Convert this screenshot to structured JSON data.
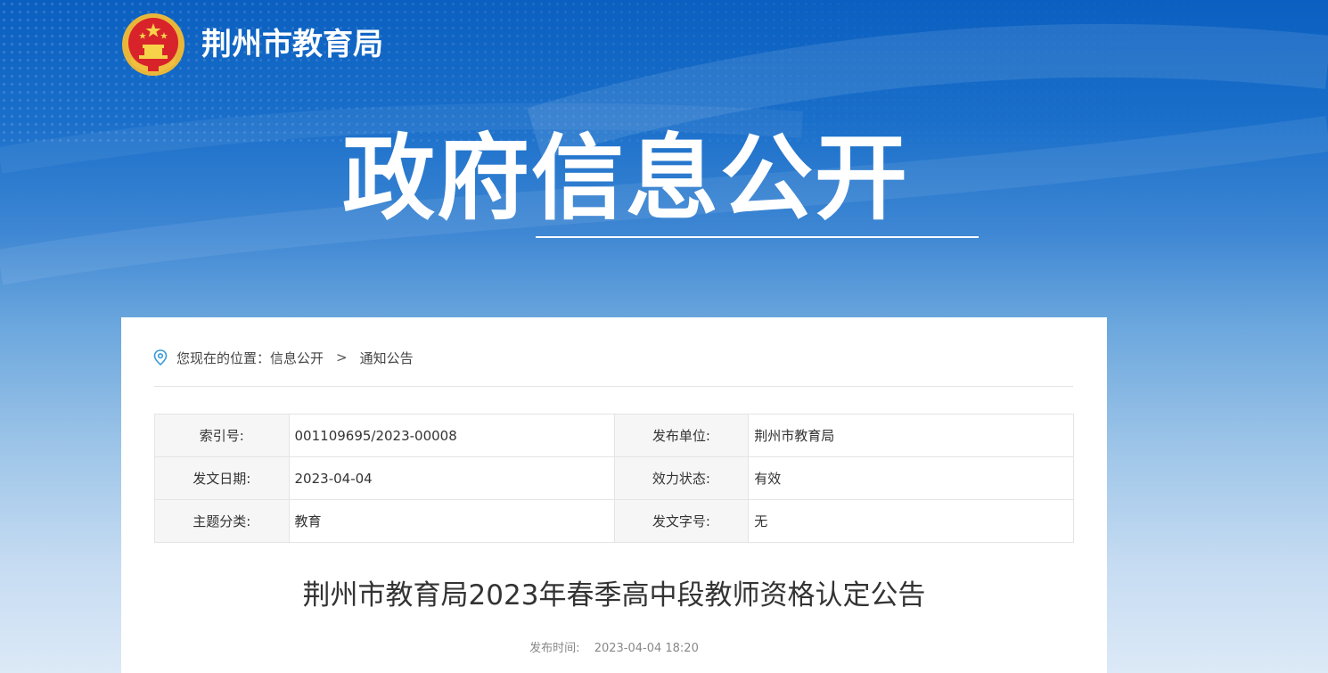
{
  "header": {
    "site_title": "荆州市教育局"
  },
  "banner": {
    "title": "政府信息公开"
  },
  "breadcrumb": {
    "prefix": "您现在的位置：",
    "items": [
      "信息公开",
      "通知公告"
    ],
    "separator": ">"
  },
  "meta": {
    "rows": [
      [
        {
          "k": "索引号:",
          "v": "001109695/2023-00008"
        },
        {
          "k": "发布单位:",
          "v": "荆州市教育局"
        }
      ],
      [
        {
          "k": "发文日期:",
          "v": "2023-04-04"
        },
        {
          "k": "效力状态:",
          "v": "有效"
        }
      ],
      [
        {
          "k": "主题分类:",
          "v": "教育"
        },
        {
          "k": "发文字号:",
          "v": "无"
        }
      ]
    ]
  },
  "article": {
    "title": "荆州市教育局2023年春季高中段教师资格认定公告",
    "publish_label": "发布时间:",
    "publish_time": "2023-04-04 18:20"
  },
  "colors": {
    "banner_top": "#0a5fc0",
    "banner_bottom": "#dce9f7",
    "accent_icon": "#3a9ad9"
  },
  "icons": {
    "emblem": "national-emblem-icon",
    "location": "location-pin-icon"
  }
}
